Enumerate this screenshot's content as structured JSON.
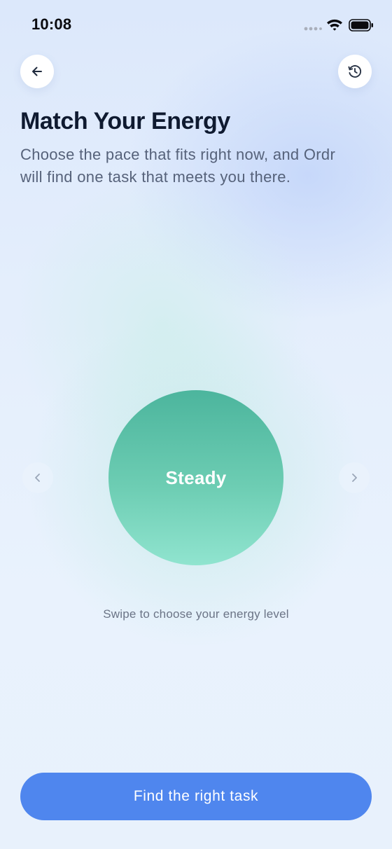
{
  "status_bar": {
    "time": "10:08"
  },
  "header": {
    "back_icon": "arrow-left-icon",
    "history_icon": "history-icon"
  },
  "main": {
    "title": "Match Your Energy",
    "subtitle": "Choose the pace that fits right now, and Ordr will find one task that meets you there.",
    "energy_level": "Steady",
    "hint": "Swipe to choose your energy level"
  },
  "cta": {
    "label": "Find the right task"
  },
  "colors": {
    "accent": "#4f86ee",
    "orb_top": "#4cb59d",
    "orb_bottom": "#90e4cf",
    "title": "#0f1a30",
    "subtitle": "#56627a"
  }
}
